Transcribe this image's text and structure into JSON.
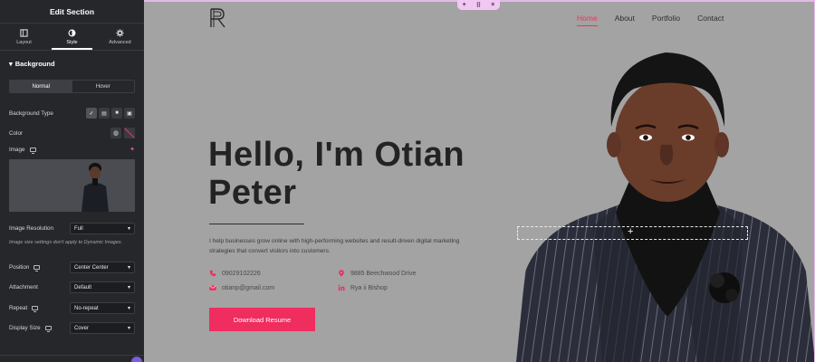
{
  "panel": {
    "header": "Edit Section",
    "tabs": [
      {
        "label": "Layout",
        "icon": "layout-icon"
      },
      {
        "label": "Style",
        "icon": "half-circle-icon"
      },
      {
        "label": "Advanced",
        "icon": "gear-icon"
      }
    ],
    "section_title": "Background",
    "state_toggle": {
      "normal": "Normal",
      "hover": "Hover"
    },
    "background_type_label": "Background Type",
    "color_label": "Color",
    "image_label": "Image",
    "image_resolution": {
      "label": "Image Resolution",
      "value": "Full"
    },
    "note": "Image size settings don't apply to Dynamic Images.",
    "position": {
      "label": "Position",
      "value": "Center Center"
    },
    "attachment": {
      "label": "Attachment",
      "value": "Default"
    },
    "repeat": {
      "label": "Repeat",
      "value": "No-repeat"
    },
    "display_size": {
      "label": "Display Size",
      "value": "Cover"
    }
  },
  "site": {
    "logo": "R",
    "nav": [
      "Home",
      "About",
      "Portfolio",
      "Contact"
    ],
    "hero_line1": "Hello, I'm Otian",
    "hero_line2": "Peter",
    "description": "I help businesses grow online with high-performing websites and result-driven digital marketing strategies that convert visitors into customers.",
    "phone": "09029102226",
    "email": "otianp@gmail.com",
    "address": "9885 Beechwood Drive",
    "linkedin": "Rya ii Bishop",
    "cta": "Download Resume"
  },
  "colors": {
    "accent": "#ef2d5e",
    "panel_bg": "#26272b",
    "canvas_bg": "#a3a3a3"
  }
}
